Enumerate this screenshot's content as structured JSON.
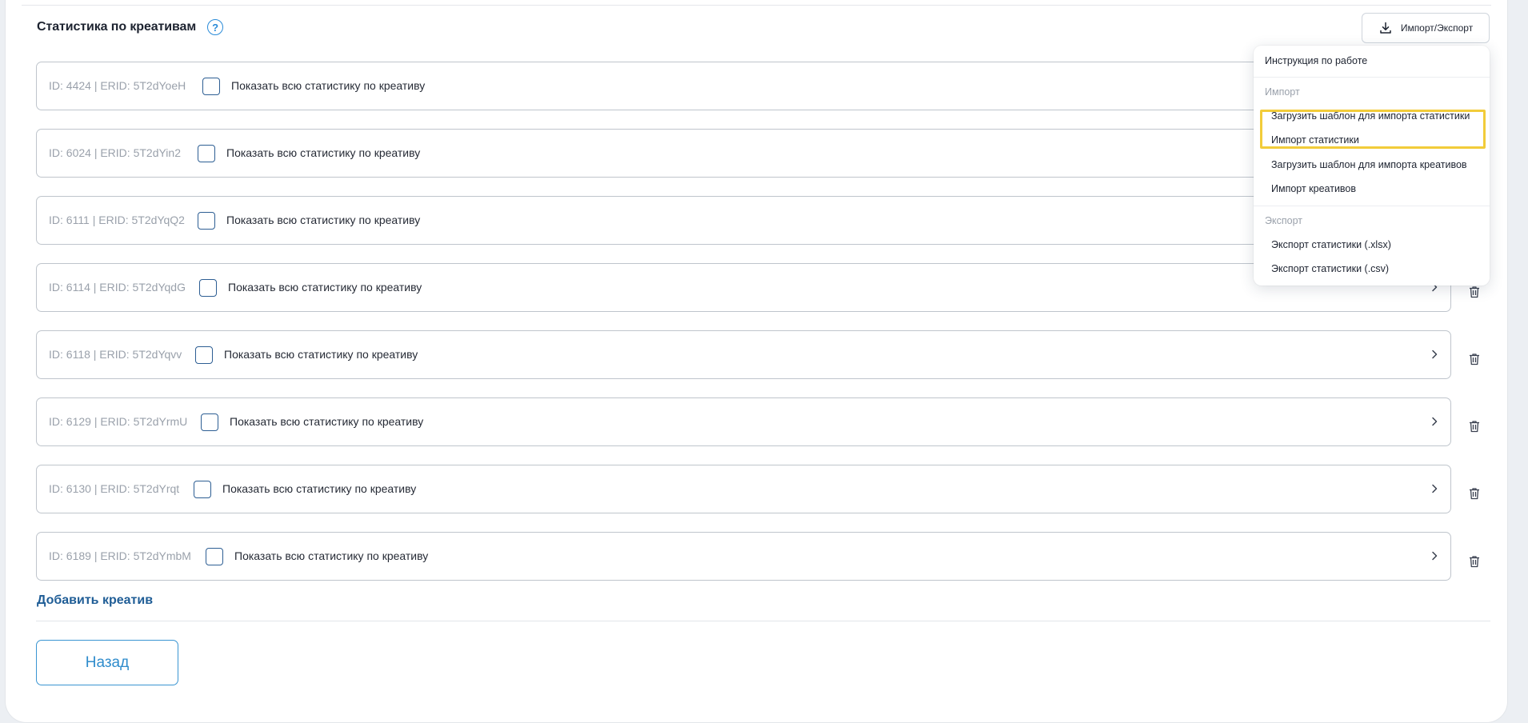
{
  "header": {
    "title": "Статистика по креативам",
    "help_icon": "?",
    "import_export_label": "Импорт/Экспорт"
  },
  "creatives": [
    {
      "id_text": "ID: 4424 | ERID: 5T2dYoeH",
      "label": "Показать всю статистику по креативу"
    },
    {
      "id_text": "ID: 6024 | ERID: 5T2dYin2",
      "label": "Показать всю статистику по креативу"
    },
    {
      "id_text": "ID: 6111 | ERID: 5T2dYqQ2",
      "label": "Показать всю статистику по креативу"
    },
    {
      "id_text": "ID: 6114 | ERID: 5T2dYqdG",
      "label": "Показать всю статистику по креативу"
    },
    {
      "id_text": "ID: 6118 | ERID: 5T2dYqvv",
      "label": "Показать всю статистику по креативу"
    },
    {
      "id_text": "ID: 6129 | ERID: 5T2dYrmU",
      "label": "Показать всю статистику по креативу"
    },
    {
      "id_text": "ID: 6130 | ERID: 5T2dYrqt",
      "label": "Показать всю статистику по креативу"
    },
    {
      "id_text": "ID: 6189 | ERID: 5T2dYmbM",
      "label": "Показать всю статистику по креативу"
    }
  ],
  "add_creative_label": "Добавить креатив",
  "back_label": "Назад",
  "dropdown": {
    "instruction": "Инструкция по работе",
    "import_section": "Импорт",
    "import_items": [
      "Загрузить шаблон для импорта статистики",
      "Импорт статистики",
      "Загрузить шаблон для импорта креативов",
      "Импорт креативов"
    ],
    "export_section": "Экспорт",
    "export_items": [
      "Экспорт статистики (.xlsx)",
      "Экспорт статистики (.csv)"
    ]
  },
  "colors": {
    "accent_blue": "#2a8bd8",
    "link_blue": "#1f5d96",
    "highlight_yellow": "#f2cc3a",
    "checkbox_border": "#2d5e93"
  },
  "icons": [
    "help-icon",
    "download-icon",
    "chevron-right-icon",
    "trash-icon"
  ]
}
